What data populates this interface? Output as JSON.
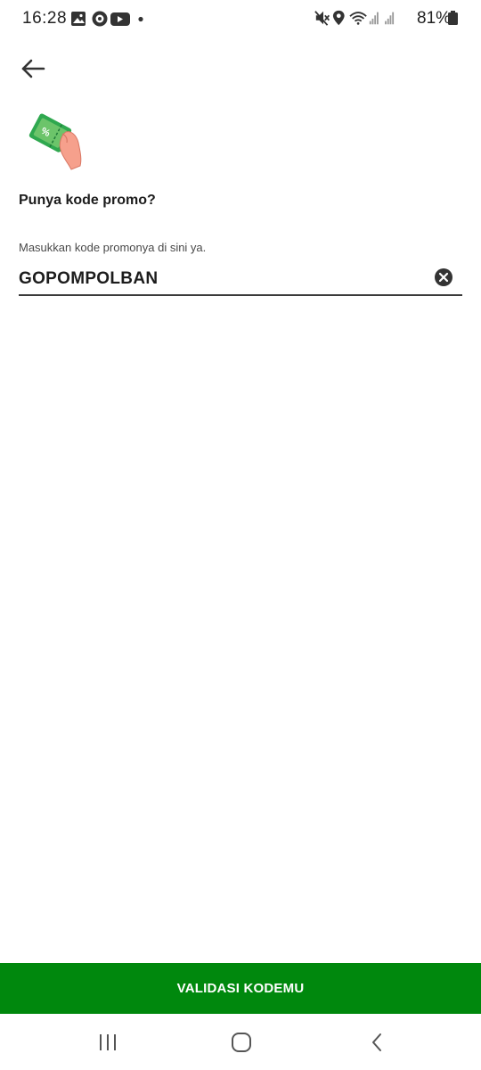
{
  "status_bar": {
    "time": "16:28",
    "battery": "81%",
    "left_icons": [
      "gallery-icon",
      "target-icon",
      "youtube-icon",
      "dot-icon"
    ],
    "right_icons": [
      "mute-icon",
      "location-icon",
      "wifi-icon",
      "signal-icon",
      "signal-icon",
      "battery-icon"
    ]
  },
  "header": {
    "back_icon": "back-arrow-icon"
  },
  "main": {
    "illustration": "promo-ticket-illustration",
    "title": "Punya kode promo?",
    "field_label": "Masukkan kode promonya di sini ya.",
    "promo_code_value": "GOPOMPOLBAN",
    "promo_code_placeholder": "",
    "clear_icon": "clear-icon"
  },
  "footer": {
    "button_label": "VALIDASI KODEMU",
    "button_color": "#00880d"
  },
  "nav_bar": {
    "items": [
      "recent-apps-icon",
      "home-icon",
      "back-icon"
    ]
  }
}
